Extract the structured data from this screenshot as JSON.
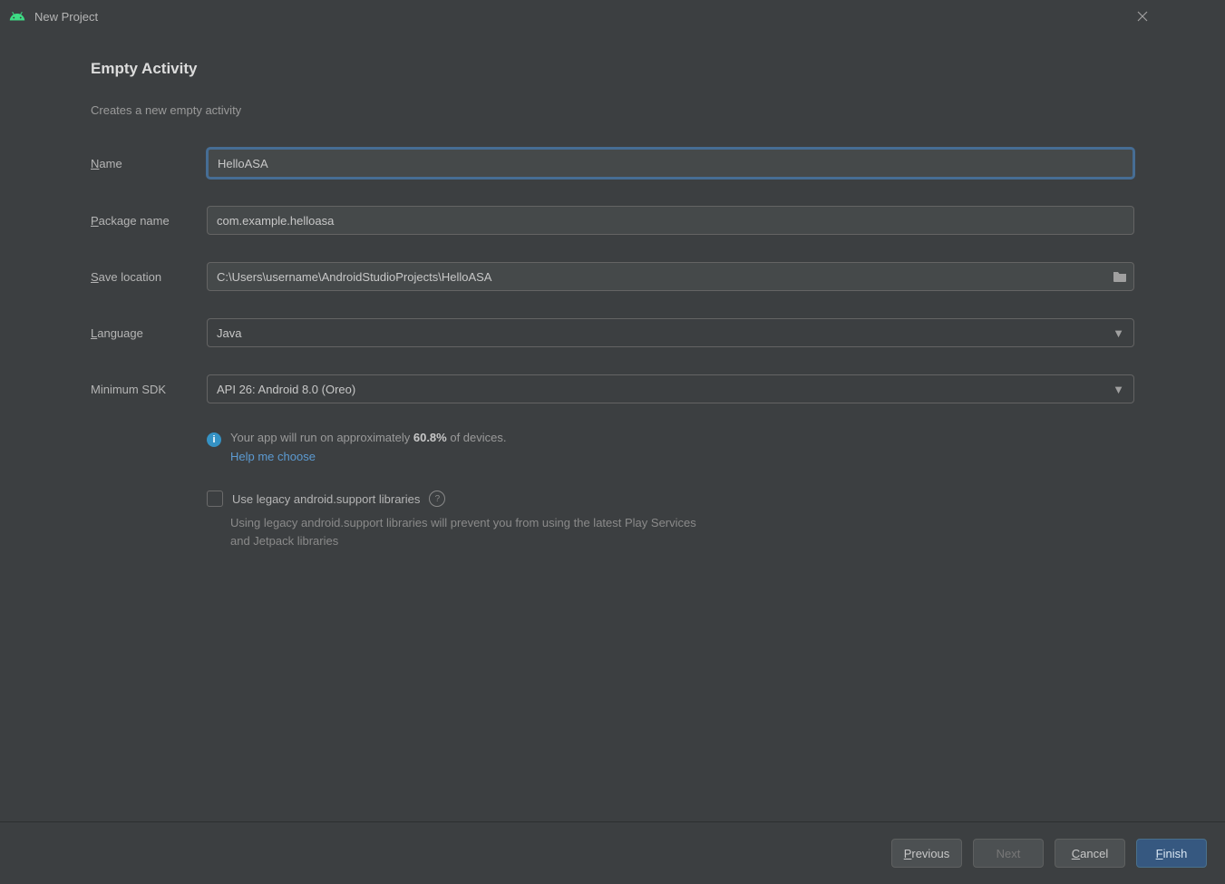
{
  "window": {
    "title": "New Project"
  },
  "header": {
    "title": "Empty Activity",
    "description": "Creates a new empty activity"
  },
  "labels": {
    "name_u": "N",
    "name": "ame",
    "pkg_u": "P",
    "pkg": "ackage name",
    "save_u": "S",
    "save": "ave location",
    "lang_u": "L",
    "lang": "anguage",
    "minsdk": "Minimum SDK"
  },
  "values": {
    "name": "HelloASA",
    "package": "com.example.helloasa",
    "save_location": "C:\\Users\\username\\AndroidStudioProjects\\HelloASA",
    "language": "Java",
    "min_sdk": "API 26: Android 8.0 (Oreo)"
  },
  "info": {
    "run_prefix": "Your app will run on approximately ",
    "run_pct": "60.8%",
    "run_suffix": " of devices.",
    "help_link": "Help me choose"
  },
  "legacy": {
    "label": "Use legacy android.support libraries",
    "note": "Using legacy android.support libraries will prevent you from using the latest Play Services and Jetpack libraries"
  },
  "buttons": {
    "prev_u": "P",
    "prev": "revious",
    "next": "Next",
    "cancel_u": "C",
    "cancel": "ancel",
    "finish_u": "F",
    "finish": "inish"
  }
}
